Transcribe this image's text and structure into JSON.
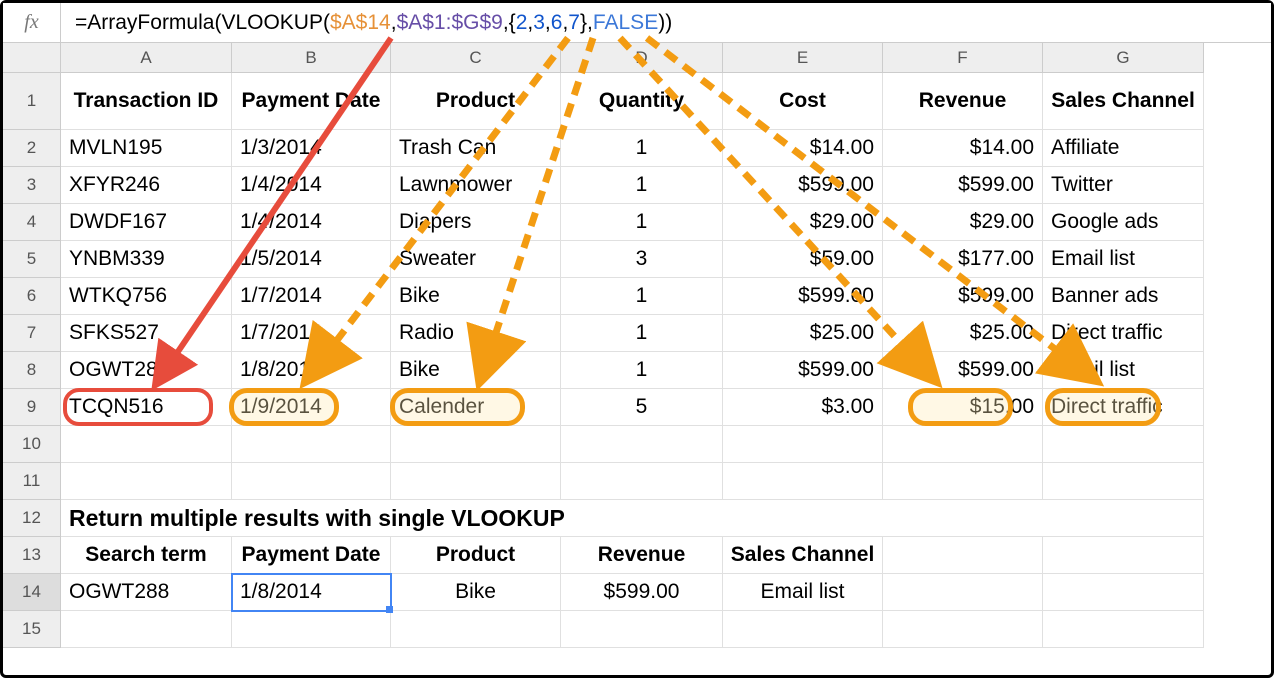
{
  "formula": {
    "prefix": "=ArrayFormula(VLOOKUP(",
    "arg1": "$A$14",
    "comma1": ",",
    "arg2": "$A$1:$G$9",
    "comma2": ",{",
    "n1": "2",
    "c1": ",",
    "n2": "3",
    "c2": ",",
    "n3": "6",
    "c3": ",",
    "n4": "7",
    "brace": "},",
    "false": "FALSE",
    "suffix": "))"
  },
  "columns": [
    "A",
    "B",
    "C",
    "D",
    "E",
    "F",
    "G"
  ],
  "row_numbers": [
    "1",
    "2",
    "3",
    "4",
    "5",
    "6",
    "7",
    "8",
    "9",
    "10",
    "11",
    "12",
    "13",
    "14",
    "15"
  ],
  "headers": {
    "A": "Transaction ID",
    "B": "Payment Date",
    "C": "Product",
    "D": "Quantity",
    "E": "Cost",
    "F": "Revenue",
    "G": "Sales Channel"
  },
  "data": [
    {
      "A": "MVLN195",
      "B": "1/3/2014",
      "C": "Trash Can",
      "D": "1",
      "E": "$14.00",
      "F": "$14.00",
      "G": "Affiliate"
    },
    {
      "A": "XFYR246",
      "B": "1/4/2014",
      "C": "Lawnmower",
      "D": "1",
      "E": "$599.00",
      "F": "$599.00",
      "G": "Twitter"
    },
    {
      "A": "DWDF167",
      "B": "1/4/2014",
      "C": "Diapers",
      "D": "1",
      "E": "$29.00",
      "F": "$29.00",
      "G": "Google ads"
    },
    {
      "A": "YNBM339",
      "B": "1/5/2014",
      "C": "Sweater",
      "D": "3",
      "E": "$59.00",
      "F": "$177.00",
      "G": "Email list"
    },
    {
      "A": "WTKQ756",
      "B": "1/7/2014",
      "C": "Bike",
      "D": "1",
      "E": "$599.00",
      "F": "$599.00",
      "G": "Banner ads"
    },
    {
      "A": "SFKS527",
      "B": "1/7/2014",
      "C": "Radio",
      "D": "1",
      "E": "$25.00",
      "F": "$25.00",
      "G": "Direct traffic"
    },
    {
      "A": "OGWT288",
      "B": "1/8/2014",
      "C": "Bike",
      "D": "1",
      "E": "$599.00",
      "F": "$599.00",
      "G": "Email list"
    },
    {
      "A": "TCQN516",
      "B": "1/9/2014",
      "C": "Calender",
      "D": "5",
      "E": "$3.00",
      "F": "$15.00",
      "G": "Direct traffic"
    }
  ],
  "section_title": "Return multiple results with single VLOOKUP",
  "result_headers": {
    "A": "Search term",
    "B": "Payment Date",
    "C": "Product",
    "D": "Revenue",
    "E": "Sales Channel"
  },
  "result_row": {
    "A": "OGWT288",
    "B": "1/8/2014",
    "C": "Bike",
    "D": "$599.00",
    "E": "Email list"
  }
}
